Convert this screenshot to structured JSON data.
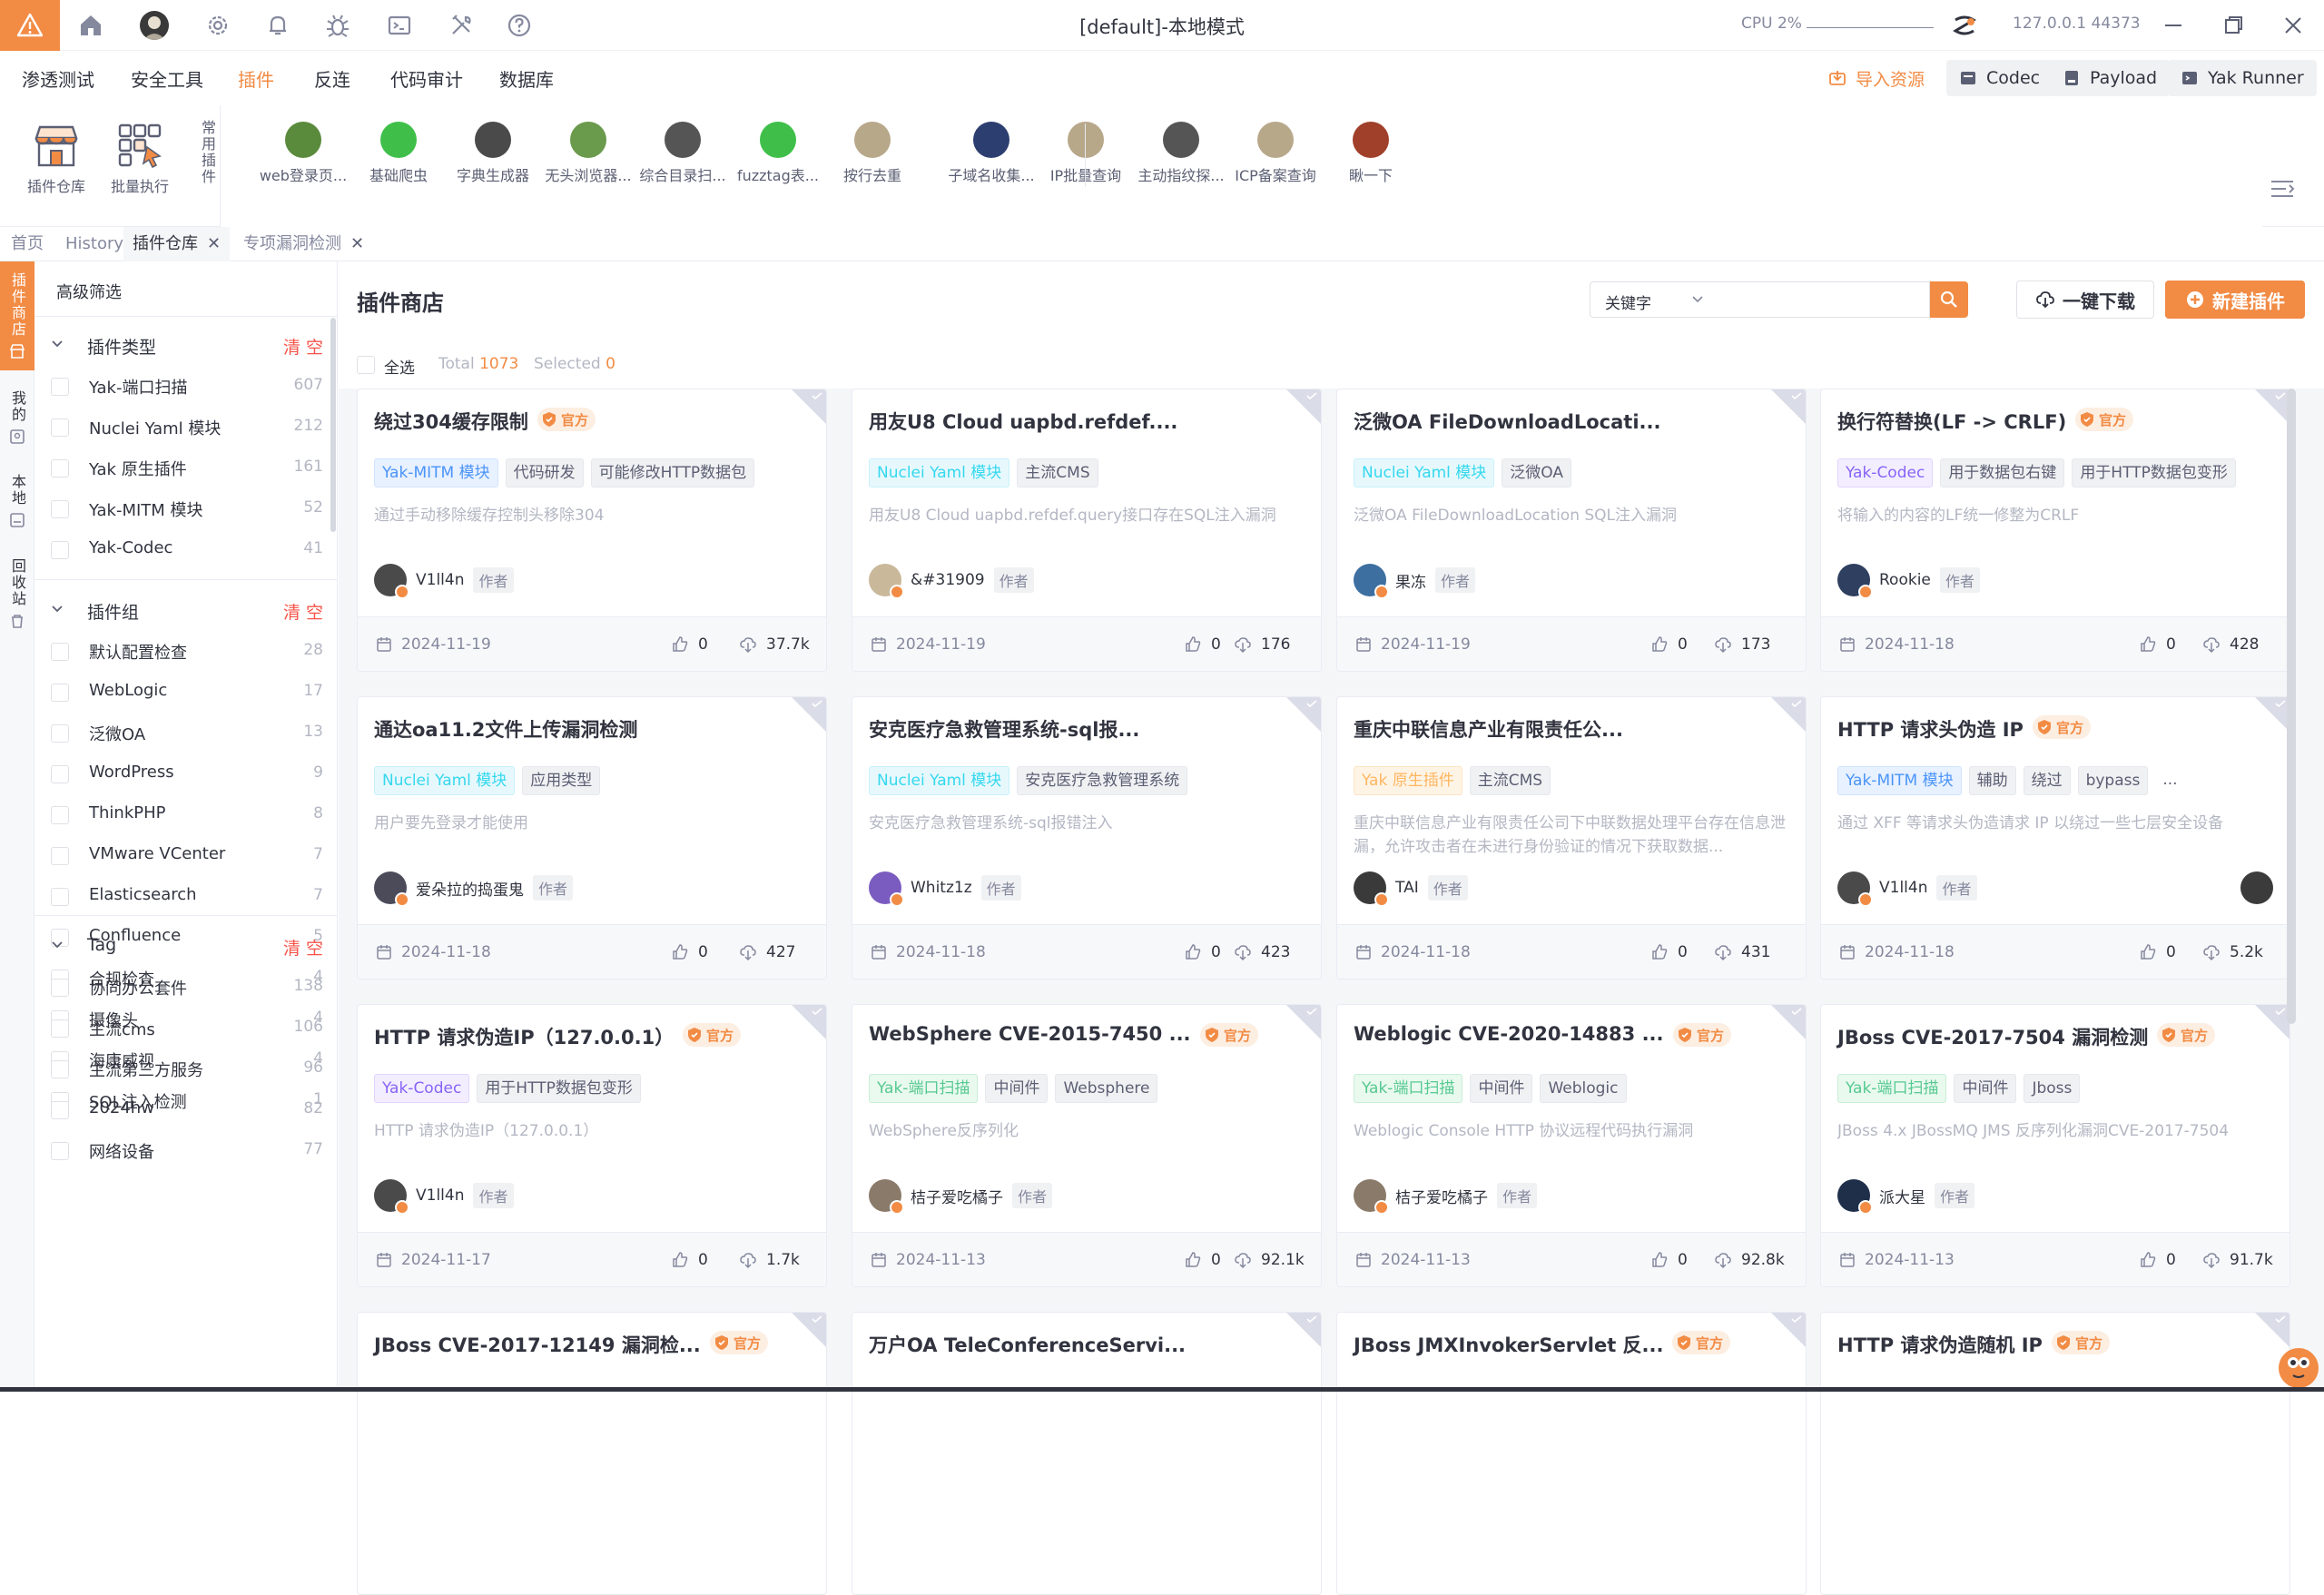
{
  "titlebar": {
    "title": "[default]-本地模式",
    "cpu_label": "CPU 2%",
    "address": "127.0.0.1 44373"
  },
  "menu": {
    "items": [
      "渗透测试",
      "安全工具",
      "插件",
      "反连",
      "代码审计",
      "数据库"
    ],
    "active_index": 2,
    "import_label": "导入资源",
    "codec_label": "Codec",
    "payload_label": "Payload",
    "runner_label": "Yak Runner"
  },
  "toolbar": {
    "store_label": "插件仓库",
    "batch_label": "批量执行",
    "common_label": "常用插件",
    "plugins": [
      {
        "label": "web登录页...",
        "color": "#5a8a3c"
      },
      {
        "label": "基础爬虫",
        "color": "#3fbf4a"
      },
      {
        "label": "字典生成器",
        "color": "#4a4a4a"
      },
      {
        "label": "无头浏览器...",
        "color": "#6a9a4c"
      },
      {
        "label": "综合目录扫...",
        "color": "#555555"
      },
      {
        "label": "fuzztag表...",
        "color": "#3fbf4a"
      },
      {
        "label": "按行去重",
        "color": "#b8a88a"
      },
      {
        "label": "子域名收集...",
        "color": "#2c3e70"
      },
      {
        "label": "IP批量查询",
        "color": "#b8a88a"
      },
      {
        "label": "主动指纹探...",
        "color": "#555555"
      },
      {
        "label": "ICP备案查询",
        "color": "#b8a88a"
      },
      {
        "label": "瞅一下",
        "color": "#a0402a"
      }
    ]
  },
  "tabs": [
    {
      "label": "首页",
      "closable": false
    },
    {
      "label": "History",
      "closable": false
    },
    {
      "label": "插件仓库",
      "closable": true
    },
    {
      "label": "专项漏洞检测",
      "closable": true
    }
  ],
  "rail": [
    "插件商店",
    "我的",
    "本地",
    "回收站"
  ],
  "sidebar": {
    "title": "高级筛选",
    "clear_label": "清 空",
    "type_group": {
      "label": "插件类型",
      "options": [
        {
          "label": "Yak-端口扫描",
          "count": "607"
        },
        {
          "label": "Nuclei Yaml 模块",
          "count": "212"
        },
        {
          "label": "Yak 原生插件",
          "count": "161"
        },
        {
          "label": "Yak-MITM 模块",
          "count": "52"
        },
        {
          "label": "Yak-Codec",
          "count": "41"
        }
      ]
    },
    "plugin_group": {
      "label": "插件组",
      "options": [
        {
          "label": "默认配置检查",
          "count": "28"
        },
        {
          "label": "WebLogic",
          "count": "17"
        },
        {
          "label": "泛微OA",
          "count": "13"
        },
        {
          "label": "WordPress",
          "count": "9"
        },
        {
          "label": "ThinkPHP",
          "count": "8"
        },
        {
          "label": "VMware VCenter",
          "count": "7"
        },
        {
          "label": "Elasticsearch",
          "count": "7"
        },
        {
          "label": "Confluence",
          "count": "5"
        },
        {
          "label": "合规检查",
          "count": "4"
        },
        {
          "label": "摄像头",
          "count": "4"
        },
        {
          "label": "海康威视",
          "count": "4"
        },
        {
          "label": "SQL注入检测",
          "count": "1"
        }
      ]
    },
    "tag_group": {
      "label": "Tag",
      "options": [
        {
          "label": "协同办公套件",
          "count": "138"
        },
        {
          "label": "主流cms",
          "count": "106"
        },
        {
          "label": "主流第三方服务",
          "count": "96"
        },
        {
          "label": "2024hw",
          "count": "82"
        },
        {
          "label": "网络设备",
          "count": "77"
        }
      ]
    }
  },
  "main": {
    "title": "插件商店",
    "keyword_label": "关键字",
    "download_label": "一键下载",
    "new_label": "新建插件",
    "select_all": "全选",
    "total_label": "Total",
    "total": "1073",
    "selected_label": "Selected",
    "selected": "0",
    "official_label": "官方",
    "author_role": "作者"
  },
  "cards": [
    {
      "title": "绕过304缓存限制",
      "official": true,
      "tags": [
        {
          "t": "Yak-MITM 模块",
          "c": "t-mitm"
        },
        {
          "t": "代码研发",
          "c": "t-default"
        },
        {
          "t": "可能修改HTTP数据包",
          "c": "t-default"
        }
      ],
      "desc": "通过手动移除缓存控制头移除304",
      "author": "V1ll4n",
      "avatar": "#4a4a4a",
      "date": "2024-11-19",
      "likes": "0",
      "downloads": "37.7k"
    },
    {
      "title": "用友U8 Cloud uapbd.refdef....",
      "official": false,
      "tags": [
        {
          "t": "Nuclei Yaml 模块",
          "c": "t-yaml"
        },
        {
          "t": "主流CMS",
          "c": "t-default"
        }
      ],
      "desc": "用友U8 Cloud uapbd.refdef.query接口存在SQL注入漏洞",
      "author": "&#31909",
      "avatar": "#c9b89a",
      "date": "2024-11-19",
      "likes": "0",
      "downloads": "176"
    },
    {
      "title": "泛微OA FileDownloadLocati...",
      "official": false,
      "tags": [
        {
          "t": "Nuclei Yaml 模块",
          "c": "t-yaml"
        },
        {
          "t": "泛微OA",
          "c": "t-default"
        }
      ],
      "desc": "泛微OA FileDownloadLocation SQL注入漏洞",
      "author": "果冻",
      "avatar": "#3d6fa0",
      "date": "2024-11-19",
      "likes": "0",
      "downloads": "173"
    },
    {
      "title": "换行符替换(LF -> CRLF)",
      "official": true,
      "tags": [
        {
          "t": "Yak-Codec",
          "c": "t-codec"
        },
        {
          "t": "用于数据包右键",
          "c": "t-default"
        },
        {
          "t": "用于HTTP数据包变形",
          "c": "t-default"
        }
      ],
      "desc": "将输入的内容的LF统一修整为CRLF",
      "author": "Rookie",
      "avatar": "#2f3f60",
      "date": "2024-11-18",
      "likes": "0",
      "downloads": "428"
    },
    {
      "title": "通达oa11.2文件上传漏洞检测",
      "official": false,
      "tags": [
        {
          "t": "Nuclei Yaml 模块",
          "c": "t-yaml"
        },
        {
          "t": "应用类型",
          "c": "t-default"
        }
      ],
      "desc": "用户要先登录才能使用",
      "author": "爱朵拉的捣蛋鬼",
      "avatar": "#4b4b5a",
      "date": "2024-11-18",
      "likes": "0",
      "downloads": "427"
    },
    {
      "title": "安克医疗急救管理系统-sql报...",
      "official": false,
      "tags": [
        {
          "t": "Nuclei Yaml 模块",
          "c": "t-yaml"
        },
        {
          "t": "安克医疗急救管理系统",
          "c": "t-default"
        }
      ],
      "desc": "安克医疗急救管理系统-sql报错注入",
      "author": "Whitz1z",
      "avatar": "#7a5cc0",
      "date": "2024-11-18",
      "likes": "0",
      "downloads": "423"
    },
    {
      "title": "重庆中联信息产业有限责任公...",
      "official": false,
      "tags": [
        {
          "t": "Yak 原生插件",
          "c": "t-native"
        },
        {
          "t": "主流CMS",
          "c": "t-default"
        }
      ],
      "desc": "重庆中联信息产业有限责任公司下中联数据处理平台存在信息泄漏，允许攻击者在未进行身份验证的情况下获取数据...",
      "author": "TAI",
      "avatar": "#3a3a3a",
      "date": "2024-11-18",
      "likes": "0",
      "downloads": "431"
    },
    {
      "title": "HTTP 请求头伪造 IP",
      "official": true,
      "tags": [
        {
          "t": "Yak-MITM 模块",
          "c": "t-mitm"
        },
        {
          "t": "辅助",
          "c": "t-default"
        },
        {
          "t": "绕过",
          "c": "t-default"
        },
        {
          "t": "bypass",
          "c": "t-default"
        },
        {
          "t": "...",
          "c": "more"
        }
      ],
      "desc": "通过 XFF 等请求头伪造请求 IP 以绕过一些七层安全设备",
      "author": "V1ll4n",
      "avatar": "#4a4a4a",
      "date": "2024-11-18",
      "likes": "0",
      "downloads": "5.2k",
      "extra_avatar": true
    },
    {
      "title": "HTTP 请求伪造IP（127.0.0.1）",
      "official": true,
      "tags": [
        {
          "t": "Yak-Codec",
          "c": "t-codec"
        },
        {
          "t": "用于HTTP数据包变形",
          "c": "t-default"
        }
      ],
      "desc": "HTTP 请求伪造IP（127.0.0.1）",
      "author": "V1ll4n",
      "avatar": "#4a4a4a",
      "date": "2024-11-17",
      "likes": "0",
      "downloads": "1.7k"
    },
    {
      "title": "WebSphere CVE-2015-7450 ...",
      "official": true,
      "tags": [
        {
          "t": "Yak-端口扫描",
          "c": "t-port"
        },
        {
          "t": "中间件",
          "c": "t-default"
        },
        {
          "t": "Websphere",
          "c": "t-default"
        }
      ],
      "desc": "WebSphere反序列化",
      "author": "桔子爱吃橘子",
      "avatar": "#8a7a6a",
      "date": "2024-11-13",
      "likes": "0",
      "downloads": "92.1k"
    },
    {
      "title": "Weblogic CVE-2020-14883 ...",
      "official": true,
      "tags": [
        {
          "t": "Yak-端口扫描",
          "c": "t-port"
        },
        {
          "t": "中间件",
          "c": "t-default"
        },
        {
          "t": "Weblogic",
          "c": "t-default"
        }
      ],
      "desc": "Weblogic Console HTTP 协议远程代码执行漏洞",
      "author": "桔子爱吃橘子",
      "avatar": "#8a7a6a",
      "date": "2024-11-13",
      "likes": "0",
      "downloads": "92.8k"
    },
    {
      "title": "JBoss CVE-2017-7504 漏洞检测",
      "official": true,
      "tags": [
        {
          "t": "Yak-端口扫描",
          "c": "t-port"
        },
        {
          "t": "中间件",
          "c": "t-default"
        },
        {
          "t": "Jboss",
          "c": "t-default"
        }
      ],
      "desc": "JBoss 4.x JBossMQ JMS 反序列化漏洞CVE-2017-7504",
      "author": "派大星",
      "avatar": "#1f2f4a",
      "date": "2024-11-13",
      "likes": "0",
      "downloads": "91.7k"
    },
    {
      "title": "JBoss CVE-2017-12149 漏洞检...",
      "official": true,
      "tags": [],
      "desc": "",
      "author": "",
      "avatar": "#4a4a4a",
      "date": "",
      "likes": "",
      "downloads": ""
    },
    {
      "title": "万户OA TeleConferenceServi...",
      "official": false,
      "tags": [],
      "desc": "",
      "author": "",
      "avatar": "#4a4a4a",
      "date": "",
      "likes": "",
      "downloads": ""
    },
    {
      "title": "JBoss JMXInvokerServlet 反...",
      "official": true,
      "tags": [],
      "desc": "",
      "author": "",
      "avatar": "#4a4a4a",
      "date": "",
      "likes": "",
      "downloads": ""
    },
    {
      "title": "HTTP 请求伪造随机 IP",
      "official": true,
      "tags": [],
      "desc": "",
      "author": "",
      "avatar": "#4a4a4a",
      "date": "",
      "likes": "",
      "downloads": ""
    }
  ],
  "colors": {
    "accent": "#f28b44",
    "danger": "#f6544a"
  }
}
